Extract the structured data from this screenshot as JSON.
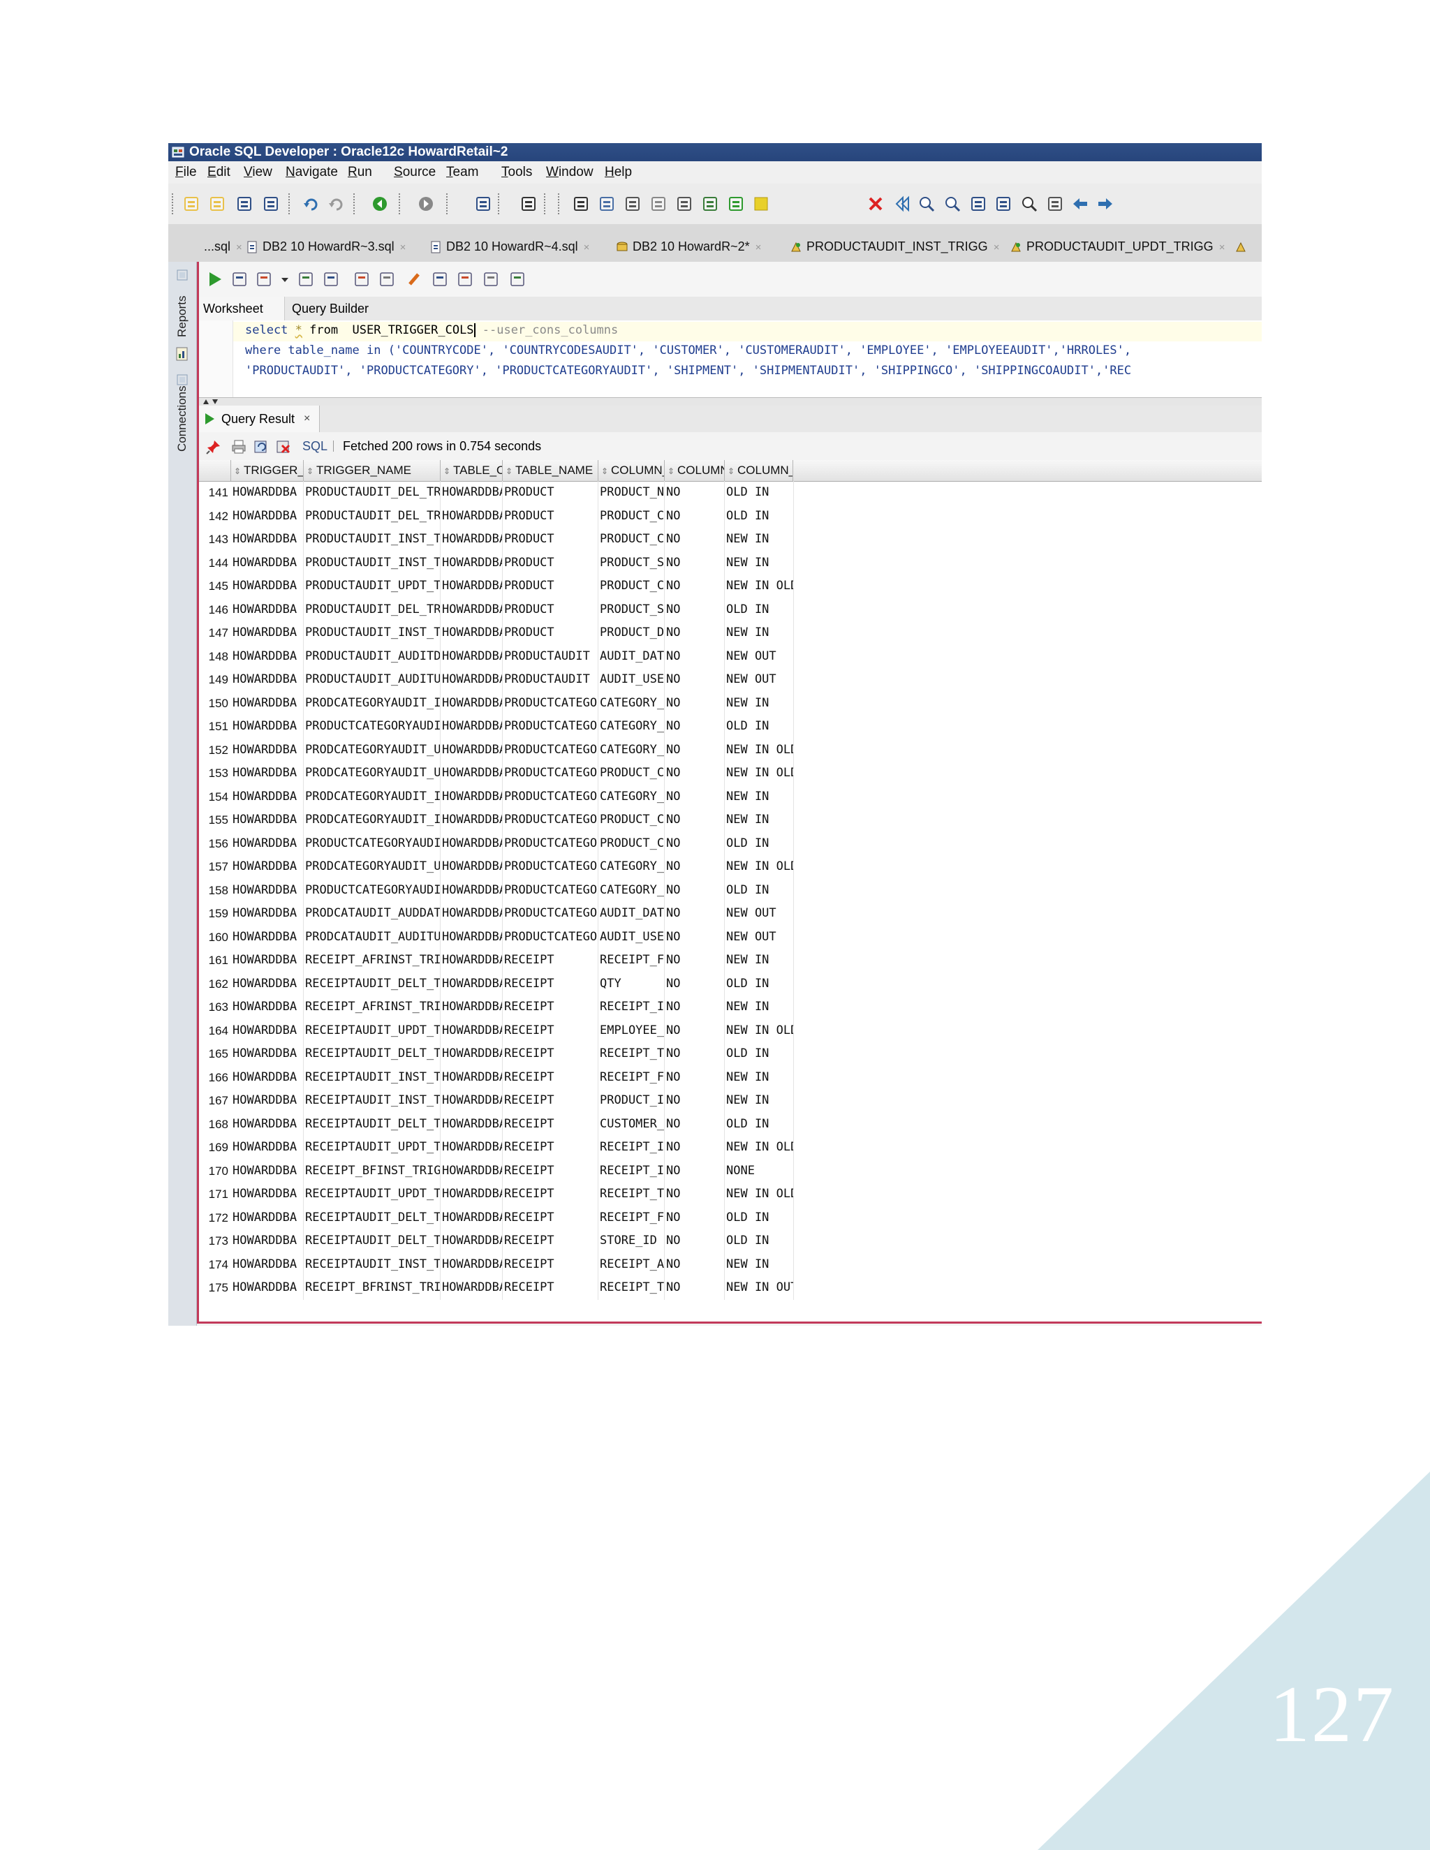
{
  "page_number": "127",
  "colors": {
    "title_bar": "#2f4f86",
    "accent_border": "#c23a5a",
    "corner_triangle": "#d3e6ec",
    "keyword_blue": "#1f3d8e"
  },
  "window": {
    "title": "Oracle SQL Developer : Oracle12c HowardRetail~2"
  },
  "menu": [
    {
      "label": "File"
    },
    {
      "label": "Edit"
    },
    {
      "label": "View"
    },
    {
      "label": "Navigate"
    },
    {
      "label": "Run"
    },
    {
      "label": "Source"
    },
    {
      "label": "Team"
    },
    {
      "label": "Tools"
    },
    {
      "label": "Window"
    },
    {
      "label": "Help"
    }
  ],
  "toolbar_icons": [
    "new-file-icon",
    "open-folder-icon",
    "save-icon",
    "save-all-icon",
    "undo-icon",
    "redo-icon",
    "back-icon",
    "forward-icon",
    "sql-worksheet-icon",
    "binoculars-icon",
    "pointer-icon",
    "grid-icon",
    "schema-icon",
    "model-icon",
    "diagram-icon",
    "export-icon",
    "arrow-icon",
    "note-icon",
    "delete-icon",
    "collapse-icon",
    "zoom-in-icon",
    "zoom-out-icon",
    "fit-icon",
    "layout-icon",
    "find-icon",
    "page-icon",
    "left-arrow-icon",
    "right-arrow-icon"
  ],
  "editor_tabs": [
    {
      "label": "...sql",
      "icon": "sql-file-icon"
    },
    {
      "label": "DB2 10 HowardR~3.sql",
      "icon": "sql-file-icon"
    },
    {
      "label": "DB2 10 HowardR~4.sql",
      "icon": "sql-file-icon"
    },
    {
      "label": "DB2 10 HowardR~2*",
      "icon": "connection-icon"
    },
    {
      "label": "PRODUCTAUDIT_INST_TRIGG",
      "icon": "trigger-icon"
    },
    {
      "label": "PRODUCTAUDIT_UPDT_TRIGG",
      "icon": "trigger-icon"
    }
  ],
  "left_panels": {
    "reports": "Reports",
    "connections": "Connections"
  },
  "worksheet_tabs": {
    "worksheet": "Worksheet",
    "query_builder": "Query Builder"
  },
  "sql": {
    "line1_select": "select ",
    "line1_star": "*",
    "line1_from": " from  USER_TRIGGER_COLS",
    "line1_comment": " --user_cons_columns",
    "line2": "where table_name in ('COUNTRYCODE', 'COUNTRYCODESAUDIT', 'CUSTOMER', 'CUSTOMERAUDIT', 'EMPLOYEE', 'EMPLOYEEAUDIT','HRROLES',",
    "line3": "'PRODUCTAUDIT', 'PRODUCTCATEGORY', 'PRODUCTCATEGORYAUDIT', 'SHIPMENT', 'SHIPMENTAUDIT', 'SHIPPINGCO', 'SHIPPINGCOAUDIT','REC"
  },
  "result_tab": {
    "label": "Query Result",
    "close": "×"
  },
  "result_bar": {
    "sql_label": "SQL",
    "status": "Fetched 200 rows in 0.754 seconds"
  },
  "columns": [
    "TRIGGER_OWNER",
    "TRIGGER_NAME",
    "TABLE_OWNER",
    "TABLE_NAME",
    "COLUMN_NAME",
    "COLUMN_LIST",
    "COLUMN_USAGE"
  ],
  "rows": [
    [
      "141",
      "HOWARDDBA",
      "PRODUCTAUDIT_DEL_TRIGG",
      "HOWARDDBA",
      "PRODUCT",
      "PRODUCT_NAME",
      "NO",
      "OLD IN"
    ],
    [
      "142",
      "HOWARDDBA",
      "PRODUCTAUDIT_DEL_TRIGG",
      "HOWARDDBA",
      "PRODUCT",
      "PRODUCT_COLOR",
      "NO",
      "OLD IN"
    ],
    [
      "143",
      "HOWARDDBA",
      "PRODUCTAUDIT_INST_TRIGG",
      "HOWARDDBA",
      "PRODUCT",
      "PRODUCT_COLOR",
      "NO",
      "NEW IN"
    ],
    [
      "144",
      "HOWARDDBA",
      "PRODUCTAUDIT_INST_TRIGG",
      "HOWARDDBA",
      "PRODUCT",
      "PRODUCT_SIZE",
      "NO",
      "NEW IN"
    ],
    [
      "145",
      "HOWARDDBA",
      "PRODUCTAUDIT_UPDT_TRIGG",
      "HOWARDDBA",
      "PRODUCT",
      "PRODUCT_COLOR",
      "NO",
      "NEW IN OLD IN"
    ],
    [
      "146",
      "HOWARDDBA",
      "PRODUCTAUDIT_DEL_TRIGG",
      "HOWARDDBA",
      "PRODUCT",
      "PRODUCT_SIZE",
      "NO",
      "OLD IN"
    ],
    [
      "147",
      "HOWARDDBA",
      "PRODUCTAUDIT_INST_TRIGG",
      "HOWARDDBA",
      "PRODUCT",
      "PRODUCT_DE...",
      "NO",
      "NEW IN"
    ],
    [
      "148",
      "HOWARDDBA",
      "PRODUCTAUDIT_AUDITDATE_TRGG",
      "HOWARDDBA",
      "PRODUCTAUDIT",
      "AUDIT_DATE",
      "NO",
      "NEW OUT"
    ],
    [
      "149",
      "HOWARDDBA",
      "PRODUCTAUDIT_AUDITUSER_TRGG",
      "HOWARDDBA",
      "PRODUCTAUDIT",
      "AUDIT_USER",
      "NO",
      "NEW OUT"
    ],
    [
      "150",
      "HOWARDDBA",
      "PRODCATEGORYAUDIT_INST_TRIGG",
      "HOWARDDBA",
      "PRODUCTCATEGORY",
      "CATEGORY_NAME",
      "NO",
      "NEW IN"
    ],
    [
      "151",
      "HOWARDDBA",
      "PRODUCTCATEGORYAUDIT_DEL_...",
      "HOWARDDBA",
      "PRODUCTCATEGORY",
      "CATEGORY_NAME",
      "NO",
      "OLD IN"
    ],
    [
      "152",
      "HOWARDDBA",
      "PRODCATEGORYAUDIT_UPT_TRIGG",
      "HOWARDDBA",
      "PRODUCTCATEGORY",
      "CATEGORY_NAME",
      "NO",
      "NEW IN OLD IN"
    ],
    [
      "153",
      "HOWARDDBA",
      "PRODCATEGORYAUDIT_UPT_TRIGG",
      "HOWARDDBA",
      "PRODUCTCATEGORY",
      "PRODUCT_CA...",
      "NO",
      "NEW IN OLD IN"
    ],
    [
      "154",
      "HOWARDDBA",
      "PRODCATEGORYAUDIT_INST_TRIGG",
      "HOWARDDBA",
      "PRODUCTCATEGORY",
      "CATEGORY_D...",
      "NO",
      "NEW IN"
    ],
    [
      "155",
      "HOWARDDBA",
      "PRODCATEGORYAUDIT_INST_TRIGG",
      "HOWARDDBA",
      "PRODUCTCATEGORY",
      "PRODUCT_CA...",
      "NO",
      "NEW IN"
    ],
    [
      "156",
      "HOWARDDBA",
      "PRODUCTCATEGORYAUDIT_DEL_...",
      "HOWARDDBA",
      "PRODUCTCATEGORY",
      "PRODUCT_CA...",
      "NO",
      "OLD IN"
    ],
    [
      "157",
      "HOWARDDBA",
      "PRODCATEGORYAUDIT_UPT_TRIGG",
      "HOWARDDBA",
      "PRODUCTCATEGORY",
      "CATEGORY_D...",
      "NO",
      "NEW IN OLD IN"
    ],
    [
      "158",
      "HOWARDDBA",
      "PRODUCTCATEGORYAUDIT_DEL_...",
      "HOWARDDBA",
      "PRODUCTCATEGORY",
      "CATEGORY_D...",
      "NO",
      "OLD IN"
    ],
    [
      "159",
      "HOWARDDBA",
      "PRODCATAUDIT_AUDDATE_TRGG",
      "HOWARDDBA",
      "PRODUCTCATEGORYA...",
      "AUDIT_DATE",
      "NO",
      "NEW OUT"
    ],
    [
      "160",
      "HOWARDDBA",
      "PRODCATAUDIT_AUDITUSER_TRGG",
      "HOWARDDBA",
      "PRODUCTCATEGORYA...",
      "AUDIT_USER",
      "NO",
      "NEW OUT"
    ],
    [
      "161",
      "HOWARDDBA",
      "RECEIPT_AFRINST_TRIGG",
      "HOWARDDBA",
      "RECEIPT",
      "RECEIPT_FI...",
      "NO",
      "NEW IN"
    ],
    [
      "162",
      "HOWARDDBA",
      "RECEIPTAUDIT_DELT_TRIGG",
      "HOWARDDBA",
      "RECEIPT",
      "QTY",
      "NO",
      "OLD IN"
    ],
    [
      "163",
      "HOWARDDBA",
      "RECEIPT_AFRINST_TRIGG",
      "HOWARDDBA",
      "RECEIPT",
      "RECEIPT_ID",
      "NO",
      "NEW IN"
    ],
    [
      "164",
      "HOWARDDBA",
      "RECEIPTAUDIT_UPDT_TRIGG",
      "HOWARDDBA",
      "RECEIPT",
      "EMPLOYEE_ID",
      "NO",
      "NEW IN OLD IN"
    ],
    [
      "165",
      "HOWARDDBA",
      "RECEIPTAUDIT_DELT_TRIGG",
      "HOWARDDBA",
      "RECEIPT",
      "RECEIPT_TAX",
      "NO",
      "OLD IN"
    ],
    [
      "166",
      "HOWARDDBA",
      "RECEIPTAUDIT_INST_TRIGG",
      "HOWARDDBA",
      "RECEIPT",
      "RECEIPT_FI...",
      "NO",
      "NEW IN"
    ],
    [
      "167",
      "HOWARDDBA",
      "RECEIPTAUDIT_INST_TRIGG",
      "HOWARDDBA",
      "RECEIPT",
      "PRODUCT_ID",
      "NO",
      "NEW IN"
    ],
    [
      "168",
      "HOWARDDBA",
      "RECEIPTAUDIT_DELT_TRIGG",
      "HOWARDDBA",
      "RECEIPT",
      "CUSTOMER_ID",
      "NO",
      "OLD IN"
    ],
    [
      "169",
      "HOWARDDBA",
      "RECEIPTAUDIT_UPDT_TRIGG",
      "HOWARDDBA",
      "RECEIPT",
      "RECEIPT_ID",
      "NO",
      "NEW IN OLD IN"
    ],
    [
      "170",
      "HOWARDDBA",
      "RECEIPT_BFINST_TRIGG",
      "HOWARDDBA",
      "RECEIPT",
      "RECEIPT_ID",
      "NO",
      "NONE"
    ],
    [
      "171",
      "HOWARDDBA",
      "RECEIPTAUDIT_UPDT_TRIGG",
      "HOWARDDBA",
      "RECEIPT",
      "RECEIPT_TAX",
      "NO",
      "NEW IN OLD IN"
    ],
    [
      "172",
      "HOWARDDBA",
      "RECEIPTAUDIT_DELT_TRIGG",
      "HOWARDDBA",
      "RECEIPT",
      "RECEIPT_FI...",
      "NO",
      "OLD IN"
    ],
    [
      "173",
      "HOWARDDBA",
      "RECEIPTAUDIT_DELT_TRIGG",
      "HOWARDDBA",
      "RECEIPT",
      "STORE_ID",
      "NO",
      "OLD IN"
    ],
    [
      "174",
      "HOWARDDBA",
      "RECEIPTAUDIT_INST_TRIGG",
      "HOWARDDBA",
      "RECEIPT",
      "RECEIPT_AM...",
      "NO",
      "NEW IN"
    ],
    [
      "175",
      "HOWARDDBA",
      "RECEIPT_BFRINST_TRIGG",
      "HOWARDDBA",
      "RECEIPT",
      "RECEIPT_TAX",
      "NO",
      "NEW IN OUT"
    ]
  ]
}
